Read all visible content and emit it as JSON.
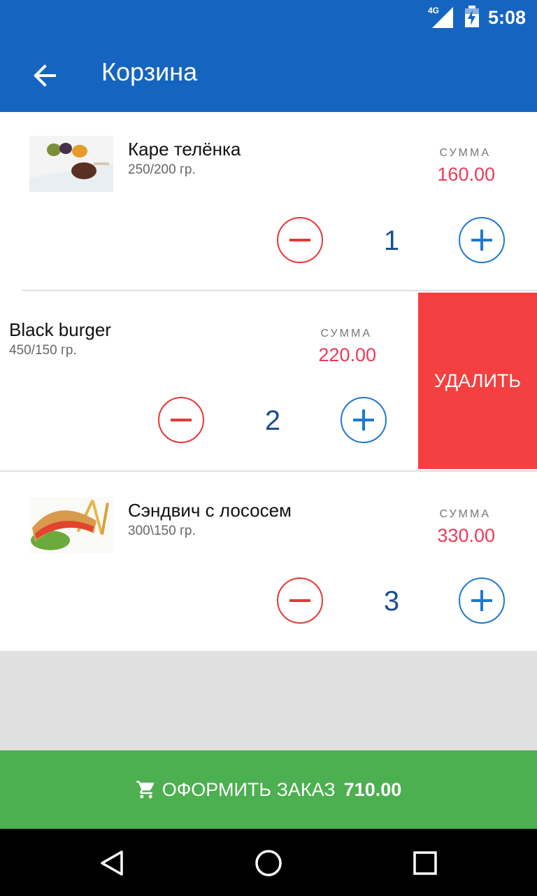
{
  "status_bar": {
    "time": "5:08",
    "network": "4G"
  },
  "app_bar": {
    "title": "Корзина",
    "back_icon": "arrow-back-icon"
  },
  "items": [
    {
      "name": "Каре телёнка",
      "weight": "250/200 гр.",
      "sum_label": "СУММА",
      "sum": "160.00",
      "qty": "1"
    },
    {
      "name": "Black burger",
      "weight": "450/150 гр.",
      "sum_label": "СУММА",
      "sum": "220.00",
      "qty": "2",
      "delete_label": "УДАЛИТЬ"
    },
    {
      "name": "Сэндвич с лососем",
      "weight": "300\\150 гр.",
      "sum_label": "СУММА",
      "sum": "330.00",
      "qty": "3"
    }
  ],
  "checkout": {
    "label": "ОФОРМИТЬ ЗАКАЗ",
    "total": "710.00",
    "icon": "cart-icon"
  },
  "colors": {
    "primary": "#1565C0",
    "price": "#EF3A57",
    "minus": "#E53935",
    "plus": "#1E78D2",
    "delete": "#F44040",
    "checkout": "#4CAF50"
  }
}
